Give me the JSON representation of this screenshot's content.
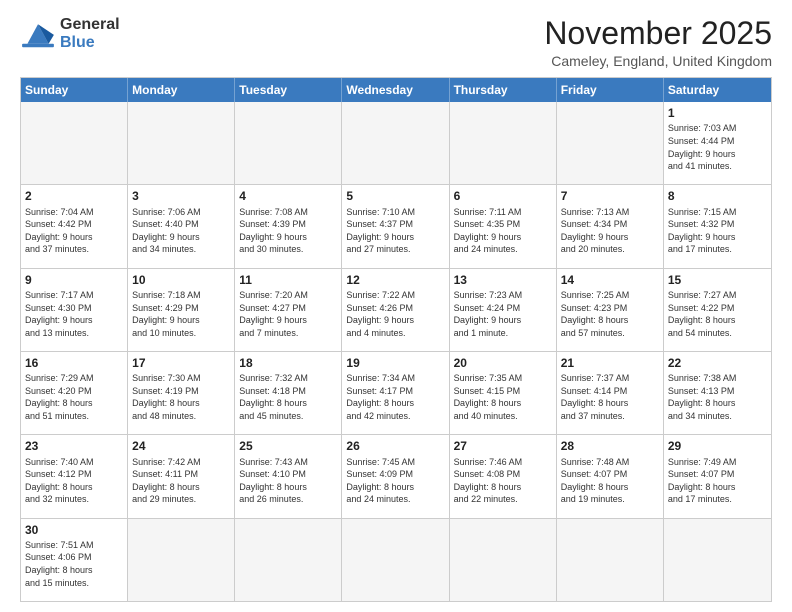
{
  "logo": {
    "line1": "General",
    "line2": "Blue"
  },
  "title": "November 2025",
  "subtitle": "Cameley, England, United Kingdom",
  "headers": [
    "Sunday",
    "Monday",
    "Tuesday",
    "Wednesday",
    "Thursday",
    "Friday",
    "Saturday"
  ],
  "weeks": [
    [
      {
        "day": "",
        "info": "",
        "empty": true
      },
      {
        "day": "",
        "info": "",
        "empty": true
      },
      {
        "day": "",
        "info": "",
        "empty": true
      },
      {
        "day": "",
        "info": "",
        "empty": true
      },
      {
        "day": "",
        "info": "",
        "empty": true
      },
      {
        "day": "",
        "info": "",
        "empty": true
      },
      {
        "day": "1",
        "info": "Sunrise: 7:03 AM\nSunset: 4:44 PM\nDaylight: 9 hours\nand 41 minutes."
      }
    ],
    [
      {
        "day": "2",
        "info": "Sunrise: 7:04 AM\nSunset: 4:42 PM\nDaylight: 9 hours\nand 37 minutes."
      },
      {
        "day": "3",
        "info": "Sunrise: 7:06 AM\nSunset: 4:40 PM\nDaylight: 9 hours\nand 34 minutes."
      },
      {
        "day": "4",
        "info": "Sunrise: 7:08 AM\nSunset: 4:39 PM\nDaylight: 9 hours\nand 30 minutes."
      },
      {
        "day": "5",
        "info": "Sunrise: 7:10 AM\nSunset: 4:37 PM\nDaylight: 9 hours\nand 27 minutes."
      },
      {
        "day": "6",
        "info": "Sunrise: 7:11 AM\nSunset: 4:35 PM\nDaylight: 9 hours\nand 24 minutes."
      },
      {
        "day": "7",
        "info": "Sunrise: 7:13 AM\nSunset: 4:34 PM\nDaylight: 9 hours\nand 20 minutes."
      },
      {
        "day": "8",
        "info": "Sunrise: 7:15 AM\nSunset: 4:32 PM\nDaylight: 9 hours\nand 17 minutes."
      }
    ],
    [
      {
        "day": "9",
        "info": "Sunrise: 7:17 AM\nSunset: 4:30 PM\nDaylight: 9 hours\nand 13 minutes."
      },
      {
        "day": "10",
        "info": "Sunrise: 7:18 AM\nSunset: 4:29 PM\nDaylight: 9 hours\nand 10 minutes."
      },
      {
        "day": "11",
        "info": "Sunrise: 7:20 AM\nSunset: 4:27 PM\nDaylight: 9 hours\nand 7 minutes."
      },
      {
        "day": "12",
        "info": "Sunrise: 7:22 AM\nSunset: 4:26 PM\nDaylight: 9 hours\nand 4 minutes."
      },
      {
        "day": "13",
        "info": "Sunrise: 7:23 AM\nSunset: 4:24 PM\nDaylight: 9 hours\nand 1 minute."
      },
      {
        "day": "14",
        "info": "Sunrise: 7:25 AM\nSunset: 4:23 PM\nDaylight: 8 hours\nand 57 minutes."
      },
      {
        "day": "15",
        "info": "Sunrise: 7:27 AM\nSunset: 4:22 PM\nDaylight: 8 hours\nand 54 minutes."
      }
    ],
    [
      {
        "day": "16",
        "info": "Sunrise: 7:29 AM\nSunset: 4:20 PM\nDaylight: 8 hours\nand 51 minutes."
      },
      {
        "day": "17",
        "info": "Sunrise: 7:30 AM\nSunset: 4:19 PM\nDaylight: 8 hours\nand 48 minutes."
      },
      {
        "day": "18",
        "info": "Sunrise: 7:32 AM\nSunset: 4:18 PM\nDaylight: 8 hours\nand 45 minutes."
      },
      {
        "day": "19",
        "info": "Sunrise: 7:34 AM\nSunset: 4:17 PM\nDaylight: 8 hours\nand 42 minutes."
      },
      {
        "day": "20",
        "info": "Sunrise: 7:35 AM\nSunset: 4:15 PM\nDaylight: 8 hours\nand 40 minutes."
      },
      {
        "day": "21",
        "info": "Sunrise: 7:37 AM\nSunset: 4:14 PM\nDaylight: 8 hours\nand 37 minutes."
      },
      {
        "day": "22",
        "info": "Sunrise: 7:38 AM\nSunset: 4:13 PM\nDaylight: 8 hours\nand 34 minutes."
      }
    ],
    [
      {
        "day": "23",
        "info": "Sunrise: 7:40 AM\nSunset: 4:12 PM\nDaylight: 8 hours\nand 32 minutes."
      },
      {
        "day": "24",
        "info": "Sunrise: 7:42 AM\nSunset: 4:11 PM\nDaylight: 8 hours\nand 29 minutes."
      },
      {
        "day": "25",
        "info": "Sunrise: 7:43 AM\nSunset: 4:10 PM\nDaylight: 8 hours\nand 26 minutes."
      },
      {
        "day": "26",
        "info": "Sunrise: 7:45 AM\nSunset: 4:09 PM\nDaylight: 8 hours\nand 24 minutes."
      },
      {
        "day": "27",
        "info": "Sunrise: 7:46 AM\nSunset: 4:08 PM\nDaylight: 8 hours\nand 22 minutes."
      },
      {
        "day": "28",
        "info": "Sunrise: 7:48 AM\nSunset: 4:07 PM\nDaylight: 8 hours\nand 19 minutes."
      },
      {
        "day": "29",
        "info": "Sunrise: 7:49 AM\nSunset: 4:07 PM\nDaylight: 8 hours\nand 17 minutes."
      }
    ],
    [
      {
        "day": "30",
        "info": "Sunrise: 7:51 AM\nSunset: 4:06 PM\nDaylight: 8 hours\nand 15 minutes."
      },
      {
        "day": "",
        "info": "",
        "empty": true
      },
      {
        "day": "",
        "info": "",
        "empty": true
      },
      {
        "day": "",
        "info": "",
        "empty": true
      },
      {
        "day": "",
        "info": "",
        "empty": true
      },
      {
        "day": "",
        "info": "",
        "empty": true
      },
      {
        "day": "",
        "info": "",
        "empty": true
      }
    ]
  ],
  "colors": {
    "header_bg": "#3a7abf",
    "accent": "#3a7abf"
  }
}
